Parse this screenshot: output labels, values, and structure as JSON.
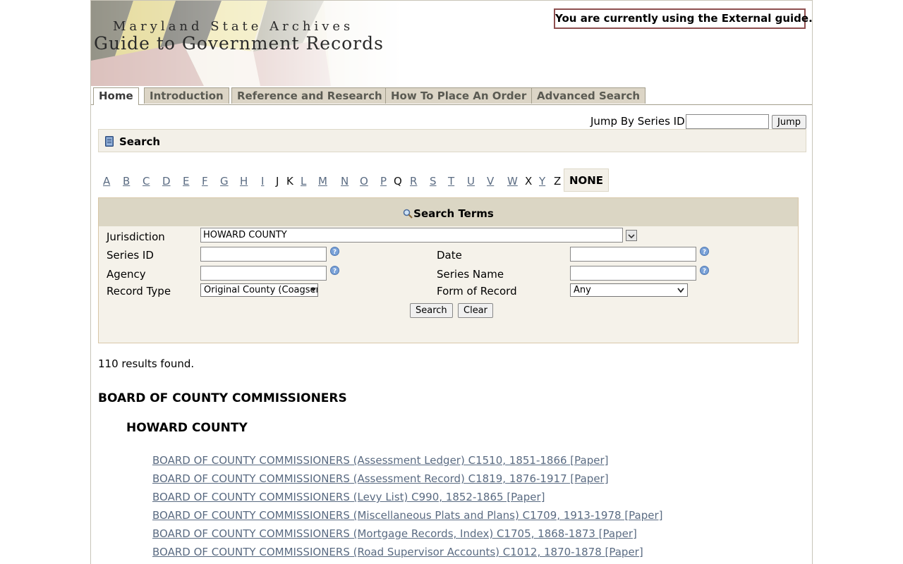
{
  "header": {
    "subtitle": "Maryland State Archives",
    "title": "Guide to Government Records",
    "guide_notice": "You are currently using the External guide."
  },
  "tabs": [
    {
      "label": "Home",
      "active": true
    },
    {
      "label": "Introduction",
      "active": false
    },
    {
      "label": "Reference and Research",
      "active": false
    },
    {
      "label": "How To Place An Order",
      "active": false
    },
    {
      "label": "Advanced Search",
      "active": false
    }
  ],
  "jump": {
    "label": "Jump By Series ID:",
    "value": "",
    "button": "Jump"
  },
  "search_section": {
    "title": "Search",
    "icon": "book-icon"
  },
  "alphabet": {
    "letters": [
      "A",
      "B",
      "C",
      "D",
      "E",
      "F",
      "G",
      "H",
      "I",
      "J",
      "K",
      "L",
      "M",
      "N",
      "O",
      "P",
      "Q",
      "R",
      "S",
      "T",
      "U",
      "V",
      "W",
      "X",
      "Y",
      "Z"
    ],
    "plain_letters": [
      "J",
      "K",
      "Q",
      "X",
      "Z"
    ],
    "none_label": "NONE"
  },
  "search_terms": {
    "title": "Search Terms",
    "icon": "magnifier-icon",
    "jurisdiction": {
      "label": "Jurisdiction",
      "value": "HOWARD COUNTY"
    },
    "series_id": {
      "label": "Series ID",
      "value": ""
    },
    "agency": {
      "label": "Agency",
      "value": ""
    },
    "record_type": {
      "label": "Record Type",
      "value": "Original County (Coagser"
    },
    "date": {
      "label": "Date",
      "value": ""
    },
    "series_name": {
      "label": "Series Name",
      "value": ""
    },
    "form_of_record": {
      "label": "Form of Record",
      "value": "Any"
    },
    "search_button": "Search",
    "clear_button": "Clear"
  },
  "results": {
    "count_text": "110 results found.",
    "heading": "BOARD OF COUNTY COMMISSIONERS",
    "subheading": "HOWARD COUNTY",
    "items": [
      "BOARD OF COUNTY COMMISSIONERS (Assessment Ledger) C1510, 1851-1866 [Paper]",
      "BOARD OF COUNTY COMMISSIONERS (Assessment Record) C1819, 1876-1917 [Paper]",
      "BOARD OF COUNTY COMMISSIONERS (Levy List) C990, 1852-1865 [Paper]",
      "BOARD OF COUNTY COMMISSIONERS (Miscellaneous Plats and Plans) C1709, 1913-1978 [Paper]",
      "BOARD OF COUNTY COMMISSIONERS (Mortgage Records, Index) C1705, 1868-1873 [Paper]",
      "BOARD OF COUNTY COMMISSIONERS (Road Supervisor Accounts) C1012, 1870-1878 [Paper]"
    ]
  },
  "colors": {
    "link": "#5a6b82",
    "tab_bg": "#dcd5c6",
    "panel_bg": "#f5f2ea",
    "panel_head": "#dbd6c4",
    "notice_border": "#8e4f4f"
  }
}
